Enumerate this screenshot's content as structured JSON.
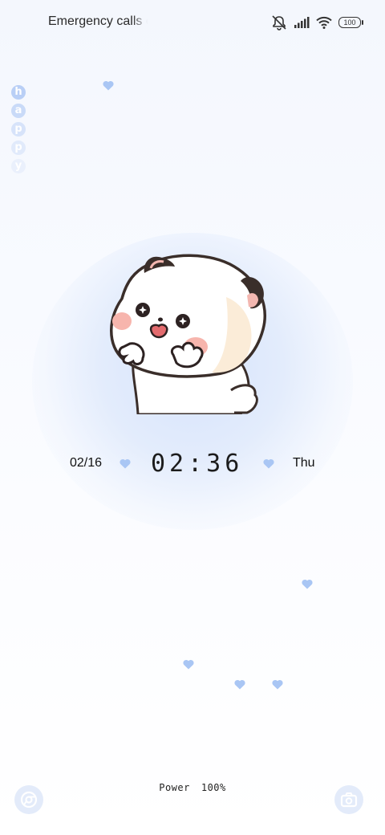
{
  "status_bar": {
    "carrier_text": "Emergency calls only",
    "battery_level": "100",
    "icons": [
      "vibrate-off-icon",
      "signal-icon",
      "wifi-icon",
      "battery-icon"
    ]
  },
  "side_letters": [
    "h",
    "a",
    "p",
    "p",
    "y"
  ],
  "clock": {
    "date": "02/16",
    "time": "02:36",
    "weekday": "Thu"
  },
  "footer": {
    "power_label": "Power",
    "power_value": "100%",
    "left_shortcut_icon": "browser-icon",
    "right_shortcut_icon": "camera-icon"
  },
  "colors": {
    "heart": "#a9c6f4",
    "accent": "#c8daf8"
  }
}
